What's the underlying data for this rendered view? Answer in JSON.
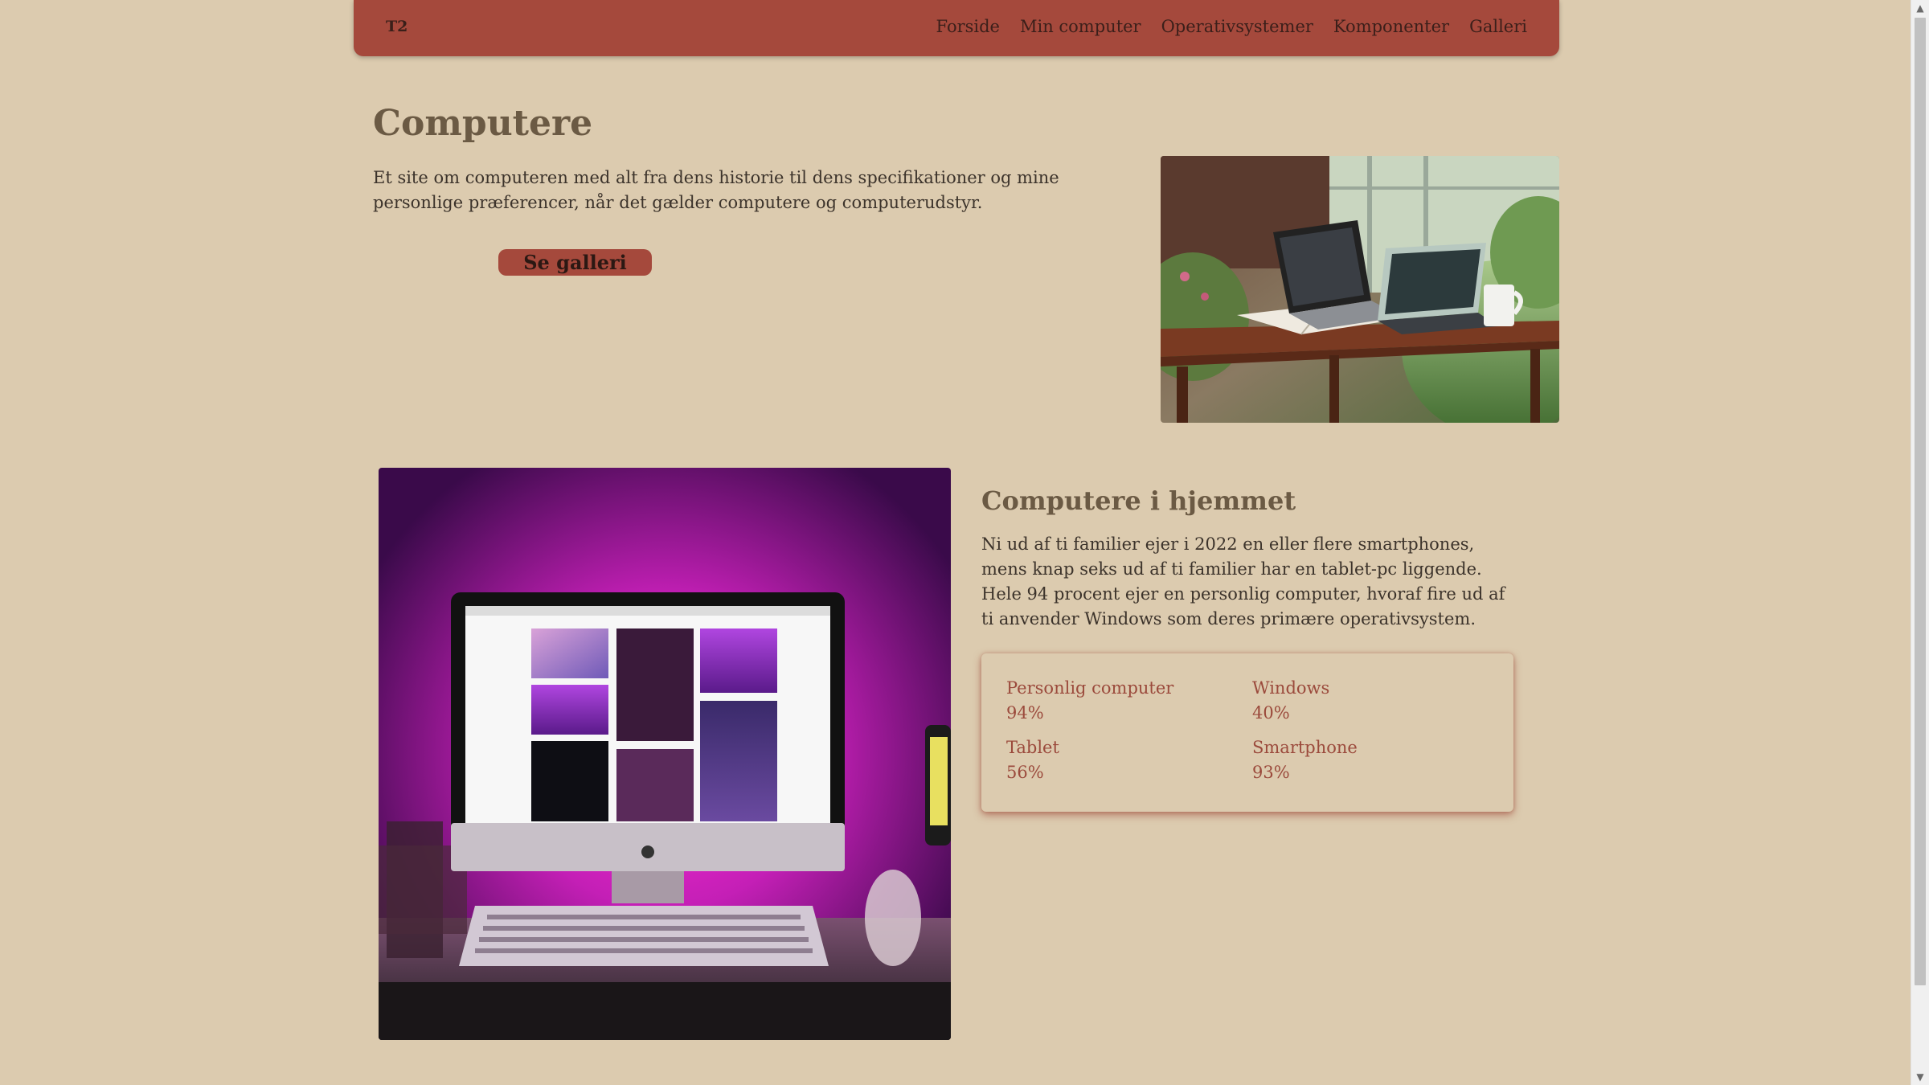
{
  "nav": {
    "brand": "T2",
    "links": [
      "Forside",
      "Min computer",
      "Operativsystemer",
      "Komponenter",
      "Galleri"
    ]
  },
  "hero": {
    "title": "Computere",
    "text": "Et site om computeren med alt fra dens historie til dens specifikationer og mine personlige præferencer, når det gælder computere og computerudstyr.",
    "button_label": "Se galleri"
  },
  "home_section": {
    "title": "Computere i hjemmet",
    "text": "Ni ud af ti familier ejer i 2022 en eller flere smartphones, mens knap seks ud af ti familier har en tablet-pc liggende. Hele 94 procent ejer en personlig computer, hvoraf fire ud af ti anvender Windows som deres primære operativsystem.",
    "stats": [
      {
        "label": "Personlig computer",
        "value": "94%"
      },
      {
        "label": "Windows",
        "value": "40%"
      },
      {
        "label": "Tablet",
        "value": "56%"
      },
      {
        "label": "Smartphone",
        "value": "93%"
      }
    ]
  },
  "colors": {
    "background": "#dccbaf",
    "accent": "#a5493c",
    "heading": "#6b5a44",
    "stat_text": "#9b4a3c"
  },
  "icons": {
    "scroll_up": "chevron-up-icon",
    "scroll_down": "chevron-down-icon"
  }
}
